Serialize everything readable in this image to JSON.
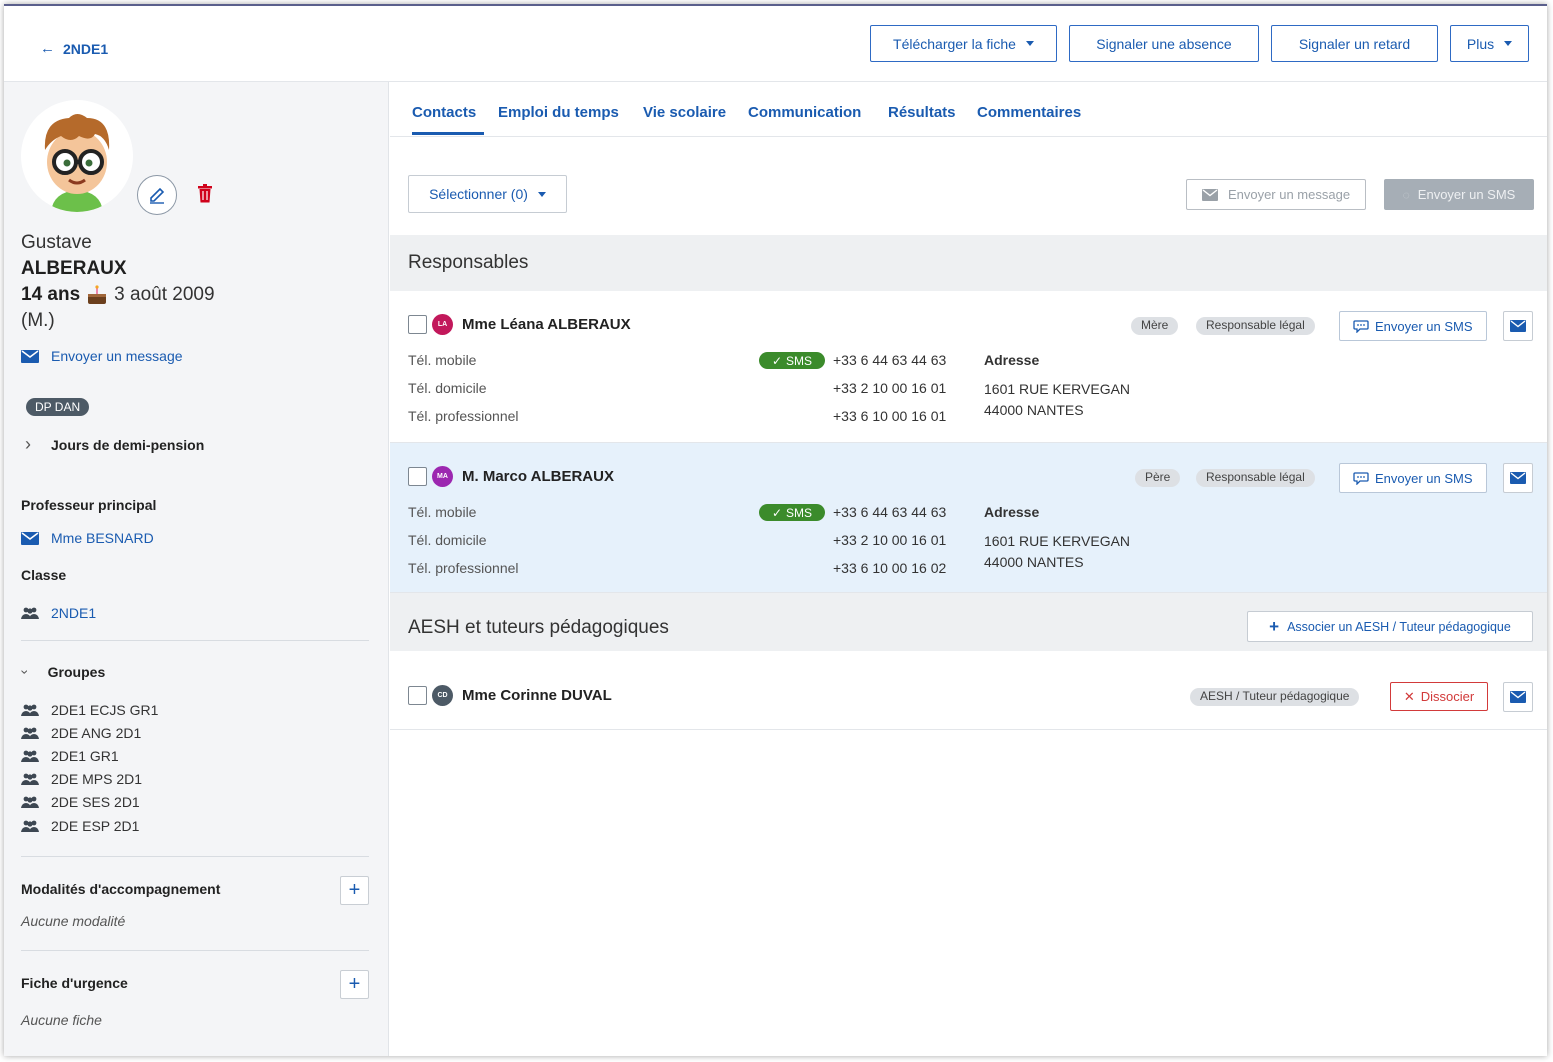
{
  "topbar": {
    "back_label": "2NDE1",
    "buttons": {
      "download": "Télécharger la fiche",
      "absence": "Signaler une absence",
      "late": "Signaler un retard",
      "more": "Plus"
    }
  },
  "student": {
    "first_name": "Gustave",
    "last_name": "ALBERAUX",
    "age": "14 ans",
    "birthdate": "3 août 2009",
    "gender": "(M.)",
    "send_message": "Envoyer un message",
    "dp_badge": "DP DAN",
    "demi_pension": "Jours de demi-pension",
    "main_teacher_heading": "Professeur principal",
    "main_teacher": "Mme BESNARD",
    "class_heading": "Classe",
    "class": "2NDE1",
    "groups_heading": "Groupes",
    "groups": [
      "2DE1 ECJS GR1",
      "2DE ANG 2D1",
      "2DE1 GR1",
      "2DE MPS 2D1",
      "2DE SES 2D1",
      "2DE ESP 2D1"
    ],
    "support_heading": "Modalités d'accompagnement",
    "support_empty": "Aucune modalité",
    "emergency_heading": "Fiche d'urgence",
    "emergency_empty": "Aucune fiche"
  },
  "tabs": [
    "Contacts",
    "Emploi du temps",
    "Vie scolaire",
    "Communication",
    "Résultats",
    "Commentaires"
  ],
  "actions": {
    "select": "Sélectionner (0)",
    "send_message": "Envoyer un message",
    "send_sms": "Envoyer un SMS"
  },
  "sections": {
    "responsables": "Responsables",
    "aesh": "AESH et tuteurs pédagogiques",
    "associate": "Associer un AESH / Tuteur pédagogique"
  },
  "labels": {
    "mobile": "Tél. mobile",
    "home": "Tél. domicile",
    "work": "Tél. professionnel",
    "address": "Adresse",
    "sms_ok": "SMS",
    "send_sms": "Envoyer un SMS",
    "legal": "Responsable légal",
    "dissociate": "Dissocier"
  },
  "contacts": [
    {
      "initials": "LA",
      "name": "Mme Léana ALBERAUX",
      "role": "Mère",
      "mobile": "+33 6 44 63 44 63",
      "home": "+33 2 10 00 16 01",
      "work": "+33 6 10 00 16 01",
      "address1": "1601 RUE KERVEGAN",
      "address2": "44000 NANTES"
    },
    {
      "initials": "MA",
      "name": "M. Marco ALBERAUX",
      "role": "Père",
      "mobile": "+33 6 44 63 44 63",
      "home": "+33 2 10 00 16 01",
      "work": "+33 6 10 00 16 02",
      "address1": "1601 RUE KERVEGAN",
      "address2": "44000 NANTES"
    }
  ],
  "aesh": {
    "initials": "CD",
    "name": "Mme Corinne DUVAL",
    "role": "AESH / Tuteur pédagogique"
  },
  "colors": {
    "accent": "#1a5bb0",
    "sms_green": "#3b8b2b",
    "highlight_row": "#e6f1fb",
    "danger": "#d23a3a",
    "mother_initials": "#c2185b",
    "father_initials": "#9c27b0",
    "aesh_initials": "#4d5a66"
  }
}
